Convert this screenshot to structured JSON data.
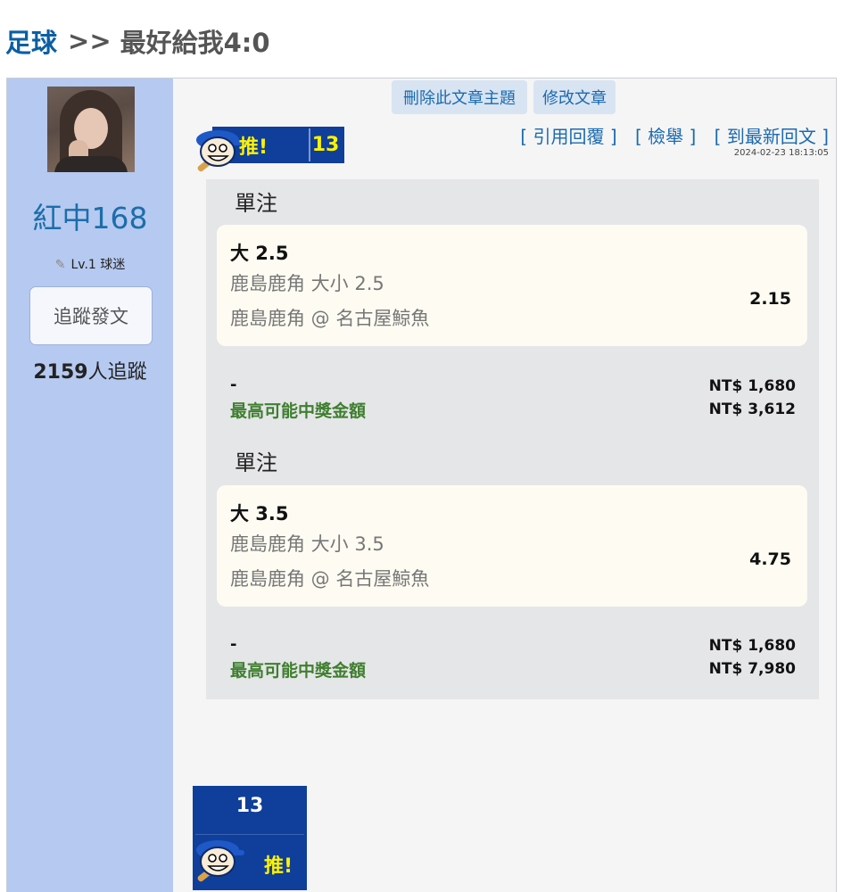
{
  "breadcrumb": {
    "category": "足球",
    "separator": ">>",
    "title": "最好給我4:0"
  },
  "author": {
    "name": "紅中168",
    "level": "Lv.1 球迷",
    "follow_button": "追蹤發文",
    "followers_count": "2159",
    "followers_suffix": "人追蹤"
  },
  "post": {
    "delete_button": "刪除此文章主題",
    "edit_button": "修改文章",
    "actions": {
      "quote_reply": "[ 引用回覆 ]",
      "report": "[ 檢舉 ]",
      "latest_reply": "[ 到最新回文 ]"
    },
    "timestamp": "2024-02-23 18:13:05",
    "push_label": "推!",
    "push_count": "13"
  },
  "bets": [
    {
      "type": "單注",
      "pick": "大 2.5",
      "market": "鹿島鹿角 大小 2.5",
      "match": "鹿島鹿角 @ 名古屋鯨魚",
      "odds": "2.15",
      "dash": "-",
      "stake": "NT$ 1,680",
      "max_payout_label": "最高可能中獎金額",
      "max_payout": "NT$ 3,612"
    },
    {
      "type": "單注",
      "pick": "大 3.5",
      "market": "鹿島鹿角 大小 3.5",
      "match": "鹿島鹿角 @ 名古屋鯨魚",
      "odds": "4.75",
      "dash": "-",
      "stake": "NT$ 1,680",
      "max_payout_label": "最高可能中獎金額",
      "max_payout": "NT$ 7,980"
    }
  ],
  "bottom_push": {
    "count": "13",
    "label": "推!"
  },
  "colors": {
    "sidebar": "#b6c9f0",
    "link_blue": "#1a6ab0",
    "badge_blue": "#0f3f9a",
    "badge_yellow": "#fff200",
    "payout_green": "#3f7f2f",
    "card_bg": "#fefcf2"
  }
}
